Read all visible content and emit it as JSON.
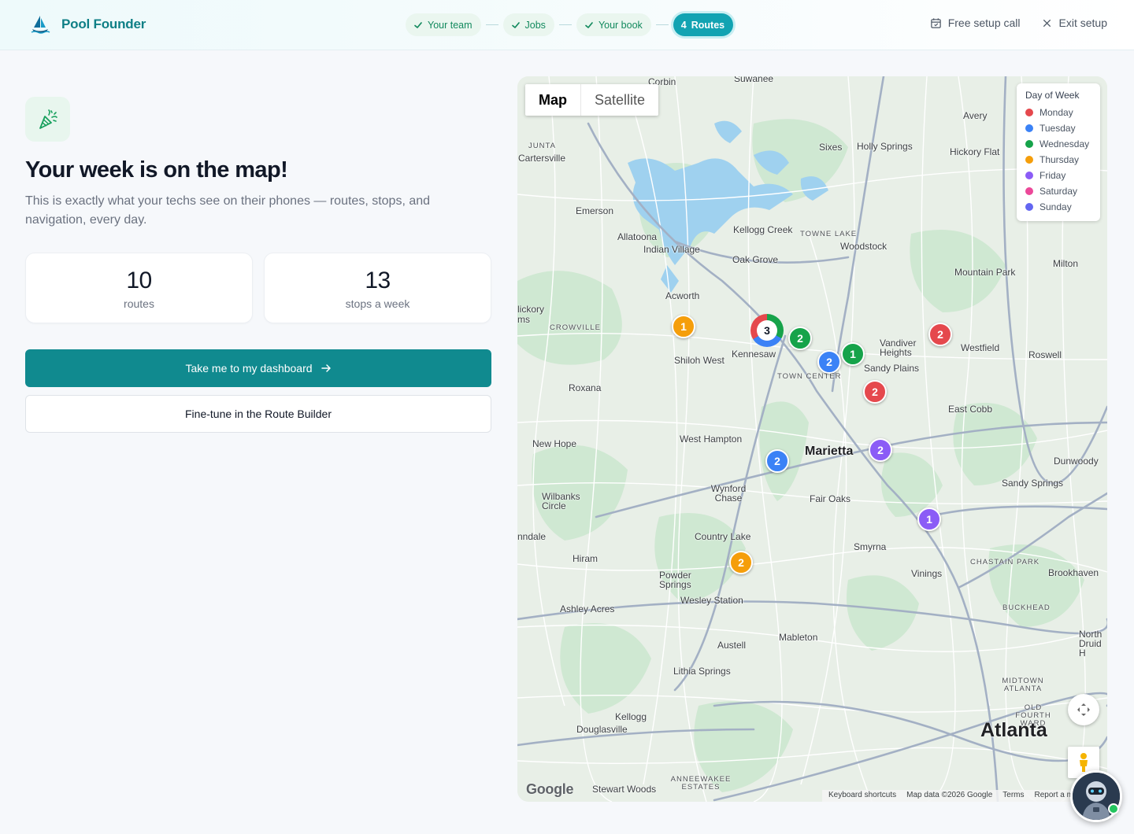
{
  "header": {
    "brand_name": "Pool Founder",
    "steps": [
      {
        "label": "Your team",
        "state": "done"
      },
      {
        "label": "Jobs",
        "state": "done"
      },
      {
        "label": "Your book",
        "state": "done"
      },
      {
        "number": "4",
        "label": "Routes",
        "state": "active"
      }
    ],
    "free_setup_call": "Free setup call",
    "exit_setup": "Exit setup"
  },
  "hero": {
    "icon": "party-popper-icon",
    "title": "Your week is on the map!",
    "subtitle": "This is exactly what your techs see on their phones — routes, stops, and navigation, every day."
  },
  "stats": [
    {
      "value": "10",
      "label": "routes"
    },
    {
      "value": "13",
      "label": "stops a week"
    }
  ],
  "actions": {
    "primary": "Take me to my dashboard",
    "secondary": "Fine-tune in the Route Builder"
  },
  "map": {
    "tabs": [
      "Map",
      "Satellite"
    ],
    "active_tab": "Map",
    "legend": {
      "title": "Day of Week",
      "items": [
        {
          "label": "Monday",
          "color": "#e5484d"
        },
        {
          "label": "Tuesday",
          "color": "#3b82f6"
        },
        {
          "label": "Wednesday",
          "color": "#16a34a"
        },
        {
          "label": "Thursday",
          "color": "#f59e0b"
        },
        {
          "label": "Friday",
          "color": "#8b5cf6"
        },
        {
          "label": "Saturday",
          "color": "#ec4899"
        },
        {
          "label": "Sunday",
          "color": "#6366f1"
        }
      ]
    },
    "markers": [
      {
        "count": "1",
        "day": "Thursday",
        "color": "#f59e0b"
      },
      {
        "count": "3",
        "day": "cluster"
      },
      {
        "count": "2",
        "day": "Wednesday",
        "color": "#16a34a"
      },
      {
        "count": "1",
        "day": "Wednesday",
        "color": "#16a34a"
      },
      {
        "count": "2",
        "day": "Tuesday",
        "color": "#3b82f6"
      },
      {
        "count": "2",
        "day": "Monday",
        "color": "#e5484d"
      },
      {
        "count": "2",
        "day": "Monday",
        "color": "#e5484d"
      },
      {
        "count": "2",
        "day": "Friday",
        "color": "#8b5cf6"
      },
      {
        "count": "2",
        "day": "Tuesday",
        "color": "#3b82f6"
      },
      {
        "count": "1",
        "day": "Friday",
        "color": "#8b5cf6"
      },
      {
        "count": "2",
        "day": "Thursday",
        "color": "#f59e0b"
      }
    ],
    "places": {
      "corbin": "Corbin",
      "suwanee": "Suwanee",
      "avery": "Avery",
      "junta": "JUNTA",
      "cartersville": "Cartersville",
      "sixes": "Sixes",
      "holly_springs": "Holly Springs",
      "hickory_flat": "Hickory Flat",
      "emerson": "Emerson",
      "kellogg_creek": "Kellogg Creek",
      "towne_lake": "TOWNE LAKE",
      "allatoona": "Allatoona",
      "indian_village": "Indian Village",
      "woodstock": "Woodstock",
      "oak_grove": "Oak Grove",
      "mountain_park": "Mountain Park",
      "milton": "Milton",
      "acworth": "Acworth",
      "hickory": "lickory",
      "crowville": "CROWVILLE",
      "vandiver": "Vandiver Heights",
      "westfield": "Westfield",
      "roswell": "Roswell",
      "kennesaw": "Kennesaw",
      "shiloh_west": "Shiloh West",
      "sandy_plains": "Sandy Plains",
      "town_center": "TOWN CENTER",
      "roxana": "Roxana",
      "east_cobb": "East Cobb",
      "west_hampton": "West Hampton",
      "marietta": "Marietta",
      "new_hope": "New Hope",
      "dunwoody": "Dunwoody",
      "sandy_springs": "Sandy Springs",
      "wilbanks": "Wilbanks Circle",
      "wynford": "Wynford Chase",
      "fair_oaks": "Fair Oaks",
      "country_lake": "Country Lake",
      "smyrna": "Smyrna",
      "hiram": "Hiram",
      "powder_springs": "Powder Springs",
      "vinings": "Vinings",
      "chastain": "CHASTAIN PARK",
      "brookhaven": "Brookhaven",
      "ashley_acres": "Ashley Acres",
      "wesley": "Wesley Station",
      "buckhead": "BUCKHEAD",
      "mableton": "Mableton",
      "austell": "Austell",
      "north_druid": "North Druid H",
      "lithia": "Lithia Springs",
      "midtown": "MIDTOWN ATLANTA",
      "old_fourth": "OLD FOURTH WARD",
      "kellogg": "Kellogg",
      "douglasville": "Douglasville",
      "atlanta": "Atlanta",
      "annewakee": "ANNEEWAKEE ESTATES",
      "stewart_woods": "Stewart Woods",
      "ndale": "nndale",
      "ms": "ms"
    },
    "google_logo": "Google",
    "attribution": [
      "Keyboard shortcuts",
      "Map data ©2026 Google",
      "Terms",
      "Report a map error"
    ]
  },
  "assistant": {
    "icon": "robot-avatar-icon",
    "status_color": "#22c55e"
  }
}
